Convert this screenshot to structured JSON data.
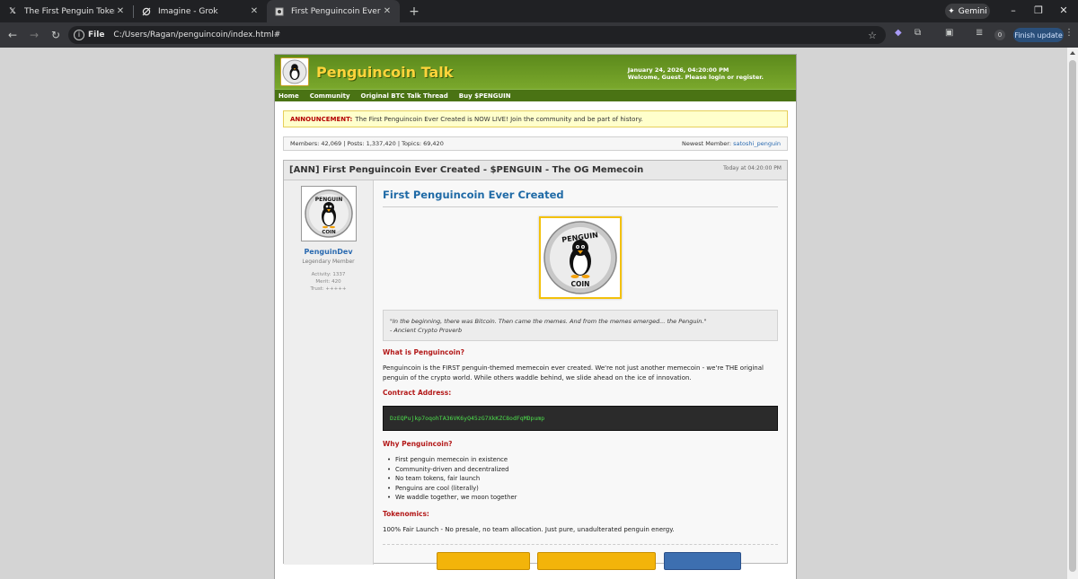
{
  "browser": {
    "tabs": [
      {
        "title": "The First Penguin Token Comm",
        "icon": "x-logo-icon"
      },
      {
        "title": "Imagine - Grok",
        "icon": "grok-icon"
      },
      {
        "title": "First Penguincoin Ever Created",
        "icon": "page-icon"
      }
    ],
    "gemini_label": "Gemini",
    "address_chip": "File",
    "address": "C:/Users/Ragan/penguincoin/index.html#",
    "update_button": "Finish update",
    "ext_badge": "0"
  },
  "forum": {
    "title": "Penguincoin Talk",
    "datetime": "January 24, 2026, 04:20:00 PM",
    "welcome": "Welcome, Guest. Please login or register.",
    "nav": [
      "Home",
      "Community",
      "Original BTC Talk Thread",
      "Buy $PENGUIN"
    ],
    "announcement_label": "ANNOUNCEMENT:",
    "announcement_text": "The First Penguincoin Ever Created is NOW LIVE! Join the community and be part of history.",
    "stats": "Members: 42,069 | Posts: 1,337,420 | Topics: 69,420",
    "newest_member_label": "Newest Member:",
    "newest_member": "satoshi_penguin"
  },
  "thread": {
    "title": "[ANN] First Penguincoin Ever Created - $PENGUIN - The OG Memecoin",
    "date": "Today at 04:20:00 PM",
    "author": {
      "name": "PenguinDev",
      "rank": "Legendary Member",
      "activity": "Activity: 1337",
      "merit": "Merit: 420",
      "trust": "Trust: +++++"
    },
    "post_title": "First Penguincoin Ever Created",
    "quote_line": "\"In the beginning, there was Bitcoin. Then came the memes. And from the memes emerged... the Penguin.\"",
    "quote_source": "- Ancient Crypto Proverb",
    "h_what": "What is Penguincoin?",
    "p_what": "Penguincoin is the FIRST penguin-themed memecoin ever created. We're not just another memecoin - we're THE original penguin of the crypto world. While others waddle behind, we slide ahead on the ice of innovation.",
    "h_contract": "Contract Address:",
    "contract": "DzEQPujkp7oqohTA36VK6yQ45zG7XkKZC8odFqMDpump",
    "h_why": "Why Penguincoin?",
    "why_items": [
      "First penguin memecoin in existence",
      "Community-driven and decentralized",
      "No team tokens, fair launch",
      "Penguins are cool (literally)",
      "We waddle together, we moon together"
    ],
    "h_tokenomics": "Tokenomics:",
    "p_tokenomics": "100% Fair Launch - No presale, no team allocation. Just pure, unadulterated penguin energy.",
    "coin_text_top": "PENGUIN",
    "coin_text_bottom": "COIN"
  },
  "colors": {
    "header_green": "#6a9a24",
    "title_yellow": "#ffd43b",
    "link_blue": "#1f6aa6",
    "heading_red": "#b31919",
    "contract_green": "#4ce04c"
  }
}
